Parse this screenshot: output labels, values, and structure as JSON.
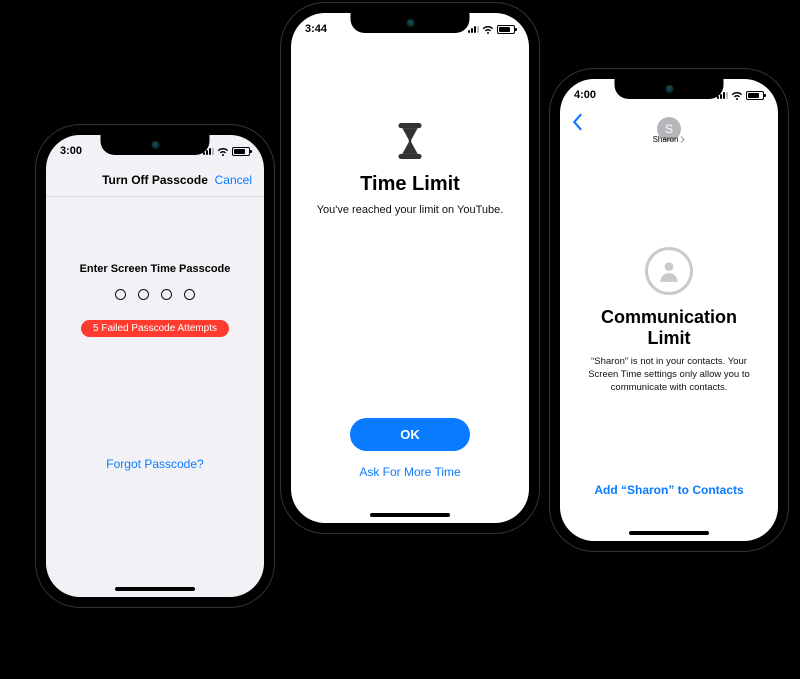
{
  "phone1": {
    "time": "3:00",
    "nav": {
      "title": "Turn Off Passcode",
      "cancel": "Cancel"
    },
    "prompt": "Enter Screen Time Passcode",
    "failBadge": "5 Failed Passcode Attempts",
    "forgot": "Forgot Passcode?"
  },
  "phone2": {
    "time": "3:44",
    "title": "Time Limit",
    "subtitle": "You've reached your limit on YouTube.",
    "okLabel": "OK",
    "askMore": "Ask For More Time"
  },
  "phone3": {
    "time": "4:00",
    "contactInitial": "S",
    "contactName": "Sharon",
    "title": "Communication Limit",
    "subtitle": "“Sharon” is not in your contacts. Your Screen Time settings only allow you to communicate with contacts.",
    "addLabel": "Add “Sharon” to Contacts"
  }
}
